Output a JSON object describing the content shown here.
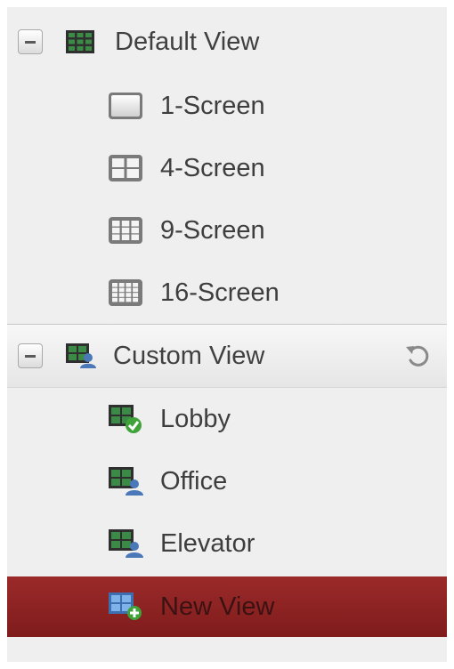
{
  "tree": {
    "default_group": {
      "label": "Default View",
      "icon": "grid-view-icon",
      "items": [
        {
          "label": "1-Screen",
          "icon": "single-screen-icon"
        },
        {
          "label": "4-Screen",
          "icon": "four-screen-icon"
        },
        {
          "label": "9-Screen",
          "icon": "nine-screen-icon"
        },
        {
          "label": "16-Screen",
          "icon": "sixteen-screen-icon"
        }
      ]
    },
    "custom_group": {
      "label": "Custom View",
      "icon": "custom-view-icon",
      "refresh_icon": "refresh-icon",
      "items": [
        {
          "label": "Lobby",
          "icon": "view-active-icon"
        },
        {
          "label": "Office",
          "icon": "view-user-icon"
        },
        {
          "label": "Elevator",
          "icon": "view-user-icon"
        },
        {
          "label": "New View",
          "icon": "view-add-icon"
        }
      ],
      "selected_item": "New View"
    }
  },
  "colors": {
    "panel_background": "#efefef",
    "selected_row": "#8c2424",
    "text": "#3e3e3e"
  }
}
